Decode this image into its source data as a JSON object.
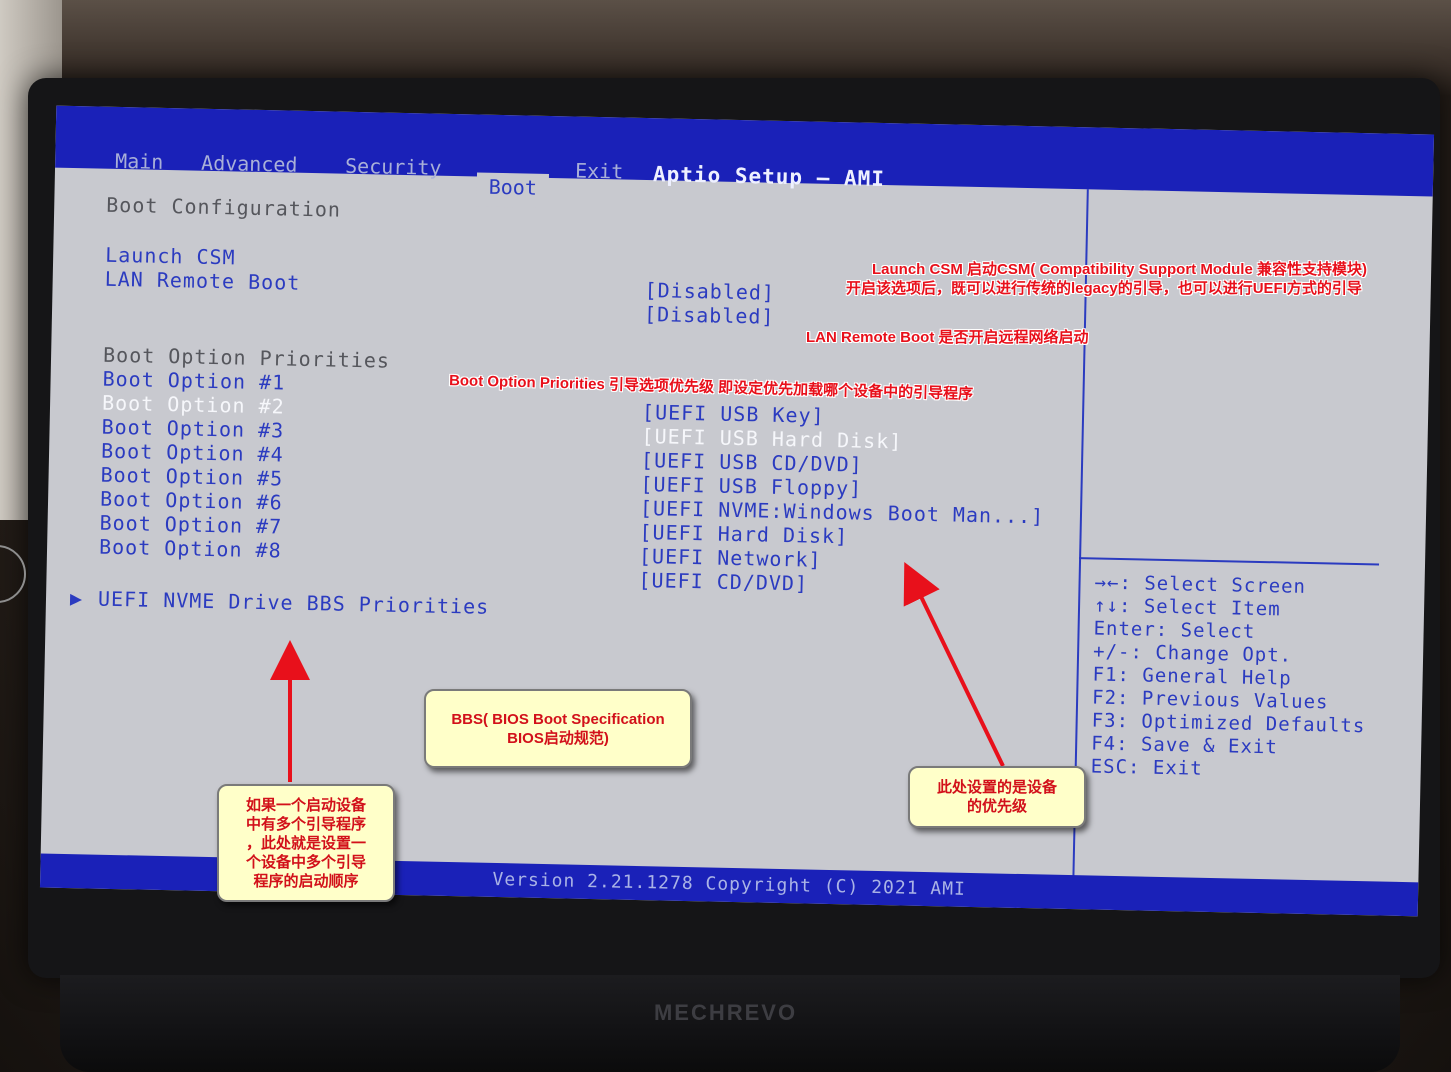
{
  "bios": {
    "app_title": "Aptio Setup – AMI",
    "tabs": [
      {
        "label": "Main",
        "active": false
      },
      {
        "label": "Advanced",
        "active": false
      },
      {
        "label": "Security",
        "active": false
      },
      {
        "label": "Boot",
        "active": true
      },
      {
        "label": "Exit",
        "active": false
      }
    ],
    "section_title": "Boot Configuration",
    "launch_csm": {
      "label": "Launch CSM",
      "value": "[Disabled]"
    },
    "lan_remote_boot": {
      "label": "LAN Remote Boot",
      "value": "[Disabled]"
    },
    "priorities_title": "Boot Option Priorities",
    "boot_options": [
      {
        "label": "Boot Option #1",
        "value": "[UEFI USB Key]"
      },
      {
        "label": "Boot Option #2",
        "value": "[UEFI USB Hard Disk]"
      },
      {
        "label": "Boot Option #3",
        "value": "[UEFI USB CD/DVD]"
      },
      {
        "label": "Boot Option #4",
        "value": "[UEFI USB Floppy]"
      },
      {
        "label": "Boot Option #5",
        "value": "[UEFI NVME:Windows Boot Man...]"
      },
      {
        "label": "Boot Option #6",
        "value": "[UEFI Hard Disk]"
      },
      {
        "label": "Boot Option #7",
        "value": "[UEFI Network]"
      },
      {
        "label": "Boot Option #8",
        "value": "[UEFI CD/DVD]"
      }
    ],
    "submenu_marker": "▶",
    "submenu_label": "UEFI NVME Drive BBS Priorities",
    "help_keys": [
      "→←: Select Screen",
      "↑↓: Select Item",
      "Enter: Select",
      "+/-: Change Opt.",
      "F1: General Help",
      "F2: Previous Values",
      "F3: Optimized Defaults",
      "F4: Save & Exit",
      "ESC: Exit"
    ],
    "version": "Version 2.21.1278 Copyright (C) 2021 AMI"
  },
  "laptop_brand": "MECHREVO",
  "annotations": {
    "csm_line1": "Launch CSM 启动CSM( Compatibility Support Module 兼容性支持模块)",
    "csm_line2": "开启该选项后，既可以进行传统的legacy的引导，也可以进行UEFI方式的引导",
    "lan": "LAN Remote Boot 是否开启远程网络启动",
    "priorities": "Boot Option Priorities 引导选项优先级 即设定优先加载哪个设备中的引导程序",
    "bbs": "BBS( BIOS Boot Specification\nBIOS启动规范)",
    "device_priority": "此处设置的是设备\n的优先级",
    "multi_boot": "如果一个启动设备\n中有多个引导程序\n，此处就是设置一\n个设备中多个引导\n程序的启动顺序"
  },
  "colors": {
    "bios_blue": "#1a21b8",
    "bios_gray": "#c8c9cf",
    "text_blue": "#2b3bc0",
    "annotation_red": "#e8101b",
    "callout_yellow": "#ffffc9"
  }
}
